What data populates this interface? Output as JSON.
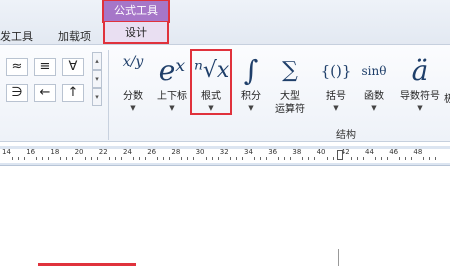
{
  "tabs": {
    "dev_tools": "发工具",
    "addins": "加载项",
    "context_header": "公式工具",
    "design": "设计"
  },
  "symbols": {
    "row1": [
      "≈",
      "≡",
      "∀"
    ],
    "row2": [
      "∋",
      "←",
      "↑"
    ],
    "scroll": [
      "▴",
      "▾",
      "▾"
    ]
  },
  "ribbon": {
    "fraction": {
      "glyph": "x/y",
      "label": "分数"
    },
    "script": {
      "glyph": "eˣ",
      "label": "上下标"
    },
    "radical": {
      "glyph": "ⁿ√x",
      "label": "根式"
    },
    "integral": {
      "glyph": "∫",
      "label": "积分"
    },
    "large_operator": {
      "glyph": "∑",
      "label": "大型",
      "label2": "运算符"
    },
    "bracket": {
      "glyph": "{()}",
      "label": "括号"
    },
    "function": {
      "glyph": "sinθ",
      "label": "函数"
    },
    "accent": {
      "glyph": "ä",
      "label": "导数符号"
    },
    "overflow": {
      "label": "极"
    },
    "group_label": "结构"
  },
  "ruler": {
    "ticks": [
      "14",
      "16",
      "18",
      "20",
      "22",
      "24",
      "26",
      "28",
      "30",
      "32",
      "34",
      "36",
      "38",
      "40",
      "42",
      "44",
      "46",
      "48"
    ]
  }
}
